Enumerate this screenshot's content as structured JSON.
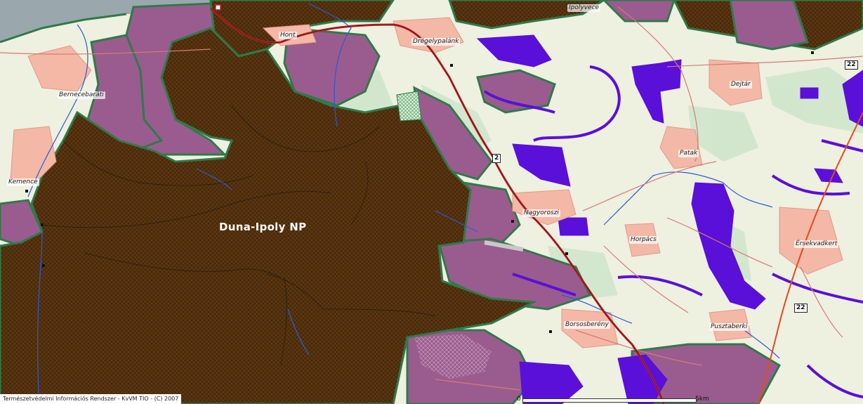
{
  "map": {
    "protected_area_label": "Duna-Ipoly NP",
    "places": {
      "hont": "Hont",
      "dregelypalank": "Drégelypalánk",
      "ipolyvece": "Ipolyvece",
      "bernecebarati": "Bernecebaráti",
      "kemence": "Kemence",
      "dejtar": "Dejtár",
      "patak": "Patak",
      "nagyoroszi": "Nagyoroszi",
      "horpacs": "Horpács",
      "ersekvadkert": "Érsekvadkert",
      "borsosbereny": "Borsosberény",
      "pusztaberki": "Pusztaberki"
    },
    "road_numbers": {
      "road_2": "2",
      "road_22_top": "22",
      "road_22_bottom": "22"
    },
    "scale": {
      "start": "0",
      "end": "5km"
    },
    "credit": "Természetvédelmi Információs Rendszer - KvVM TIO - (C) 2007",
    "colors": {
      "park": "#4a2a08",
      "park_border": "#2f7a4a",
      "natura": "#9a5c8e",
      "protected_blue": "#5a10d8",
      "settlement": "#f4b8a6",
      "forest_light": "#cfe6cd",
      "road_main": "#b8262a",
      "river": "#2a5ad8",
      "water": "#9aa8ad"
    }
  }
}
